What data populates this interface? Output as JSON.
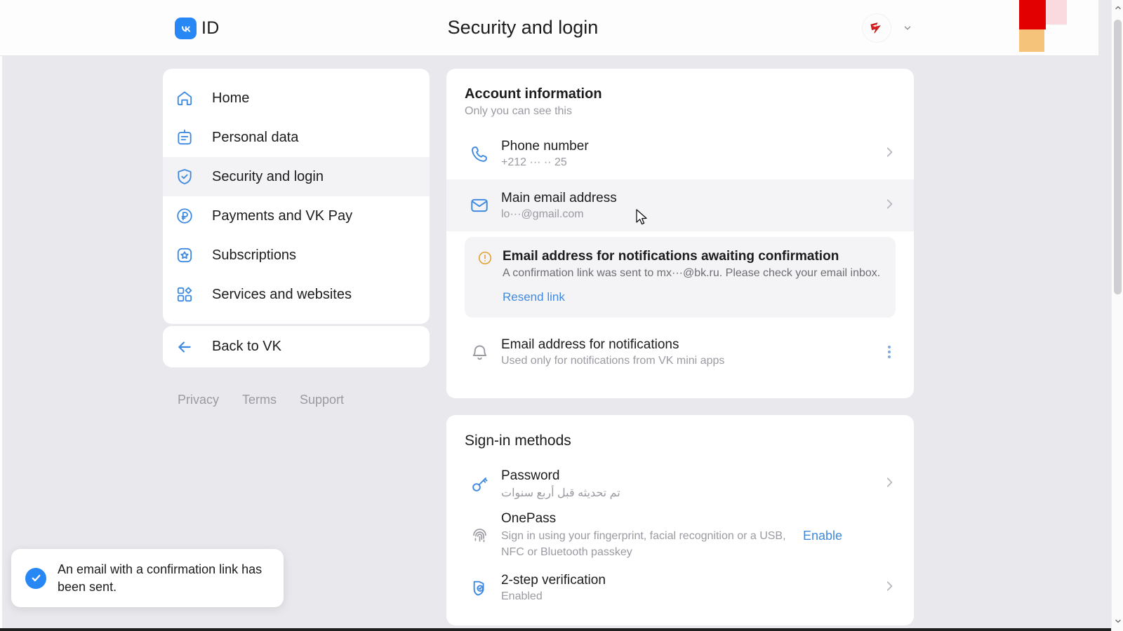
{
  "header": {
    "logo_text": "ID",
    "logo_mark": "VK",
    "title": "Security and login",
    "avatar_icon": "user-avatar",
    "chevron_icon": "chevron-down-icon"
  },
  "swatches": {
    "red": "#e30000",
    "pink": "#fadade",
    "orange": "#f5c37a"
  },
  "sidebar": {
    "items": [
      {
        "label": "Home",
        "icon": "home-icon",
        "selected": false
      },
      {
        "label": "Personal data",
        "icon": "personal-data-icon",
        "selected": false
      },
      {
        "label": "Security and login",
        "icon": "shield-check-icon",
        "selected": true
      },
      {
        "label": "Payments and VK Pay",
        "icon": "ruble-circle-icon",
        "selected": false
      },
      {
        "label": "Subscriptions",
        "icon": "star-badge-icon",
        "selected": false
      },
      {
        "label": "Services and websites",
        "icon": "grid-apps-icon",
        "selected": false
      }
    ],
    "back": {
      "label": "Back to VK",
      "icon": "arrow-left-icon"
    },
    "footer": [
      "Privacy",
      "Terms",
      "Support"
    ]
  },
  "account": {
    "title": "Account information",
    "subtitle": "Only you can see this",
    "rows": [
      {
        "title": "Phone number",
        "sub": "+212 ··· ·· 25",
        "icon": "phone-icon",
        "hovered": false
      },
      {
        "title": "Main email address",
        "sub": "lo···@gmail.com",
        "icon": "mail-icon",
        "hovered": true
      }
    ],
    "banner": {
      "icon": "warning-circle-icon",
      "title": "Email address for notifications awaiting confirmation",
      "text": "A confirmation link was sent to mx···@bk.ru. Please check your email inbox.",
      "link": "Resend link"
    },
    "notification_row": {
      "title": "Email address for notifications",
      "sub": "Used only for notifications from VK mini apps",
      "icon": "bell-icon",
      "menu_icon": "kebab-menu-icon"
    }
  },
  "signin": {
    "title": "Sign-in methods",
    "rows": [
      {
        "title": "Password",
        "sub": "تم تحديثه قبل أربع سنوات",
        "icon": "key-icon",
        "action": "",
        "rtl": true
      },
      {
        "title": "OnePass",
        "sub": "Sign in using your fingerprint, facial recognition or a USB, NFC or Bluetooth passkey",
        "icon": "fingerprint-icon",
        "action": "Enable",
        "rtl": false
      },
      {
        "title": "2-step verification",
        "sub": "Enabled",
        "icon": "shield-check-small-icon",
        "action": "",
        "rtl": false
      }
    ]
  },
  "toast": {
    "icon": "check-circle-icon",
    "message": "An email with a confirmation link has been sent."
  },
  "scrollbar": {
    "up_icon": "scroll-up-arrow",
    "down_icon": "scroll-down-arrow"
  },
  "colors": {
    "accent_blue": "#3f8ae0",
    "brand_blue": "#2787f5",
    "warning_amber": "#e0a030",
    "page_bg": "#e9e9ed"
  }
}
